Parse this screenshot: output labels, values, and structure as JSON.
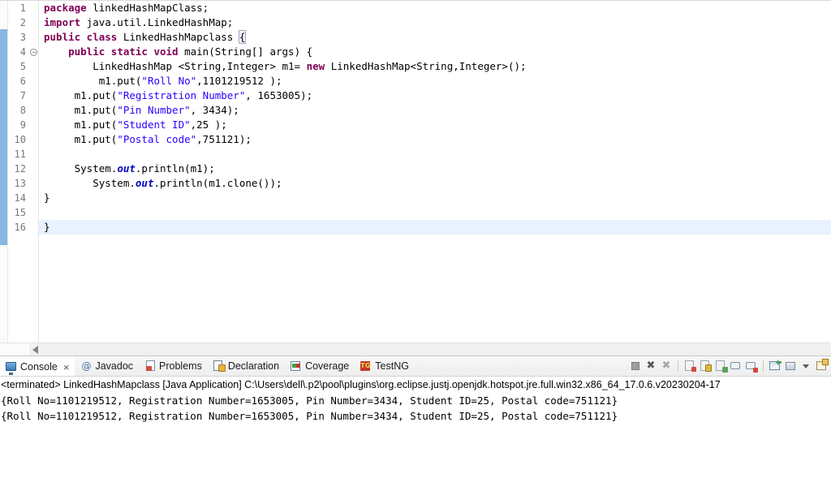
{
  "editor": {
    "lines": [
      {
        "num": "1",
        "fold": false,
        "current": false,
        "tokens": [
          {
            "t": "package",
            "c": "kw"
          },
          {
            "t": " linkedHashMapClass;",
            "c": "plain"
          }
        ]
      },
      {
        "num": "2",
        "fold": false,
        "current": false,
        "tokens": [
          {
            "t": "import",
            "c": "kw"
          },
          {
            "t": " java.util.LinkedHashMap;",
            "c": "plain"
          }
        ]
      },
      {
        "num": "3",
        "fold": false,
        "current": false,
        "tokens": [
          {
            "t": "public class",
            "c": "kw"
          },
          {
            "t": " LinkedHashMapclass ",
            "c": "plain"
          },
          {
            "t": "{",
            "c": "brace-hl"
          }
        ]
      },
      {
        "num": "4",
        "fold": true,
        "current": false,
        "tokens": [
          {
            "t": "    ",
            "c": "plain"
          },
          {
            "t": "public static void",
            "c": "kw"
          },
          {
            "t": " main(String[] args) {",
            "c": "plain"
          }
        ]
      },
      {
        "num": "5",
        "fold": false,
        "current": false,
        "tokens": [
          {
            "t": "        LinkedHashMap <String,Integer> m1= ",
            "c": "plain"
          },
          {
            "t": "new",
            "c": "kw"
          },
          {
            "t": " LinkedHashMap<String,Integer>();",
            "c": "plain"
          }
        ]
      },
      {
        "num": "6",
        "fold": false,
        "current": false,
        "tokens": [
          {
            "t": "         m1.put(",
            "c": "plain"
          },
          {
            "t": "\"Roll No\"",
            "c": "str"
          },
          {
            "t": ",1101219512 );",
            "c": "plain"
          }
        ]
      },
      {
        "num": "7",
        "fold": false,
        "current": false,
        "tokens": [
          {
            "t": "     m1.put(",
            "c": "plain"
          },
          {
            "t": "\"Registration Number\"",
            "c": "str"
          },
          {
            "t": ", 1653005);",
            "c": "plain"
          }
        ]
      },
      {
        "num": "8",
        "fold": false,
        "current": false,
        "tokens": [
          {
            "t": "     m1.put(",
            "c": "plain"
          },
          {
            "t": "\"Pin Number\"",
            "c": "str"
          },
          {
            "t": ", 3434);",
            "c": "plain"
          }
        ]
      },
      {
        "num": "9",
        "fold": false,
        "current": false,
        "tokens": [
          {
            "t": "     m1.put(",
            "c": "plain"
          },
          {
            "t": "\"Student ID\"",
            "c": "str"
          },
          {
            "t": ",25 );",
            "c": "plain"
          }
        ]
      },
      {
        "num": "10",
        "fold": false,
        "current": false,
        "tokens": [
          {
            "t": "     m1.put(",
            "c": "plain"
          },
          {
            "t": "\"Postal code\"",
            "c": "str"
          },
          {
            "t": ",751121);",
            "c": "plain"
          }
        ]
      },
      {
        "num": "11",
        "fold": false,
        "current": false,
        "tokens": []
      },
      {
        "num": "12",
        "fold": false,
        "current": false,
        "tokens": [
          {
            "t": "     System.",
            "c": "plain"
          },
          {
            "t": "out",
            "c": "stat"
          },
          {
            "t": ".println(m1);",
            "c": "plain"
          }
        ]
      },
      {
        "num": "13",
        "fold": false,
        "current": false,
        "tokens": [
          {
            "t": "        System.",
            "c": "plain"
          },
          {
            "t": "out",
            "c": "stat"
          },
          {
            "t": ".println(m1.clone());",
            "c": "plain"
          }
        ]
      },
      {
        "num": "14",
        "fold": false,
        "current": false,
        "tokens": [
          {
            "t": "}",
            "c": "plain"
          }
        ]
      },
      {
        "num": "15",
        "fold": false,
        "current": false,
        "tokens": []
      },
      {
        "num": "16",
        "fold": false,
        "current": true,
        "tokens": [
          {
            "t": "}",
            "c": "plain"
          }
        ]
      },
      {
        "num": "",
        "fold": false,
        "current": false,
        "tokens": []
      },
      {
        "num": "",
        "fold": false,
        "current": false,
        "tokens": []
      },
      {
        "num": "",
        "fold": false,
        "current": false,
        "tokens": []
      },
      {
        "num": "",
        "fold": false,
        "current": false,
        "tokens": []
      },
      {
        "num": "",
        "fold": false,
        "current": false,
        "tokens": []
      },
      {
        "num": "",
        "fold": false,
        "current": false,
        "tokens": []
      },
      {
        "num": "",
        "fold": false,
        "current": false,
        "tokens": []
      }
    ],
    "scrollbar": {
      "left_arrow_icon": "triangle-left-icon"
    }
  },
  "console": {
    "tabs": [
      {
        "label": "Console",
        "icon": "console-monitor-icon",
        "active": true,
        "closable": true,
        "close_label": "×"
      },
      {
        "label": "Javadoc",
        "icon": "javadoc-at-icon",
        "active": false,
        "closable": false,
        "close_label": ""
      },
      {
        "label": "Problems",
        "icon": "problems-error-icon",
        "active": false,
        "closable": false,
        "close_label": ""
      },
      {
        "label": "Declaration",
        "icon": "declaration-icon",
        "active": false,
        "closable": false,
        "close_label": ""
      },
      {
        "label": "Coverage",
        "icon": "coverage-icon",
        "active": false,
        "closable": false,
        "close_label": ""
      },
      {
        "label": "TestNG",
        "icon": "testng-icon",
        "active": false,
        "closable": false,
        "close_label": ""
      }
    ],
    "toolbar": [
      {
        "name": "terminate-button",
        "glyph": ""
      },
      {
        "name": "terminate-all-button",
        "glyph": "✖"
      },
      {
        "name": "remove-all-terminated-button",
        "glyph": "✖"
      },
      {
        "name": "separator-1",
        "glyph": ""
      },
      {
        "name": "clear-console-button",
        "glyph": ""
      },
      {
        "name": "scroll-lock-button",
        "glyph": ""
      },
      {
        "name": "word-wrap-button",
        "glyph": ""
      },
      {
        "name": "show-console-on-output-button",
        "glyph": ""
      },
      {
        "name": "show-console-on-error-button",
        "glyph": ""
      },
      {
        "name": "separator-2",
        "glyph": ""
      },
      {
        "name": "pin-console-button",
        "glyph": ""
      },
      {
        "name": "display-selected-console-button",
        "glyph": ""
      },
      {
        "name": "console-menu-dropdown",
        "glyph": ""
      },
      {
        "name": "open-console-button",
        "glyph": ""
      }
    ],
    "process_header": "<terminated> LinkedHashMapclass [Java Application] C:\\Users\\dell\\.p2\\pool\\plugins\\org.eclipse.justj.openjdk.hotspot.jre.full.win32.x86_64_17.0.6.v20230204-17",
    "output": [
      "{Roll No=1101219512, Registration Number=1653005, Pin Number=3434, Student ID=25, Postal code=751121}",
      "{Roll No=1101219512, Registration Number=1653005, Pin Number=3434, Student ID=25, Postal code=751121}"
    ]
  },
  "colors": {
    "keyword": "#7f0055",
    "string": "#2a00ff",
    "static_field": "#0000c0",
    "change_bar": "#6fa8dc",
    "current_line": "#e8f2fe",
    "gutter_text": "#787878"
  }
}
